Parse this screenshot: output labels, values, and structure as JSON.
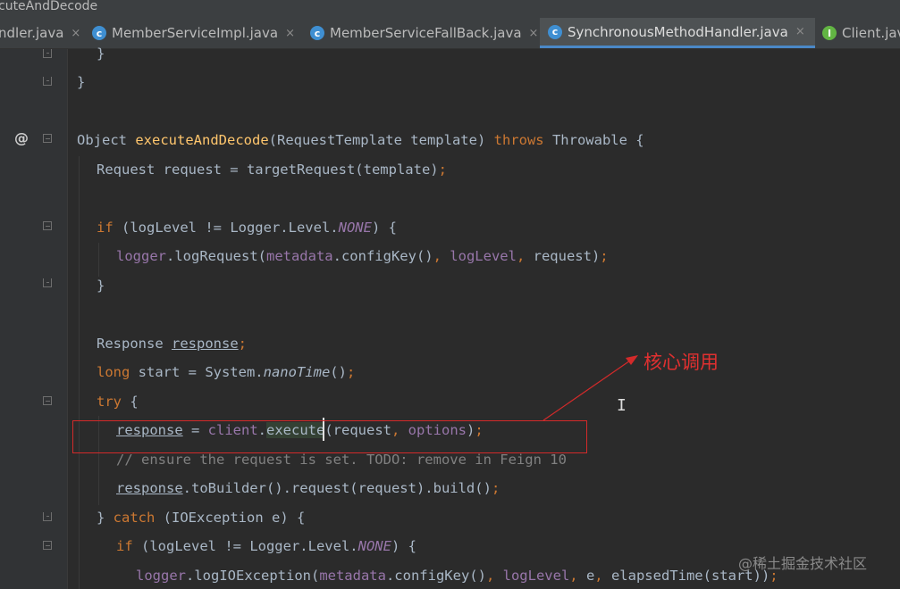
{
  "window": {
    "title": "cuteAndDecode"
  },
  "tabs": [
    {
      "label": "ndler.java",
      "active": false,
      "icon": "none"
    },
    {
      "label": "MemberServiceImpl.java",
      "active": false,
      "icon": "class-icon"
    },
    {
      "label": "MemberServiceFallBack.java",
      "active": false,
      "icon": "class-icon"
    },
    {
      "label": "SynchronousMethodHandler.java",
      "active": true,
      "icon": "class-icon"
    },
    {
      "label": "Client.jav",
      "active": false,
      "icon": "interface-icon"
    }
  ],
  "tab_close": "×",
  "gutter": {
    "override_marker": "@"
  },
  "code": {
    "l1": "}",
    "l2": "}",
    "l3_type": "Object",
    "l3_name": "executeAndDecode",
    "l3_params": "(RequestTemplate template)",
    "l3_throws": "throws",
    "l3_rest": " Throwable {",
    "l4_a": "Request request = targetRequest(template)",
    "l4_semi": ";",
    "l5_if": "if",
    "l5_a": " (logLevel != Logger.Level.",
    "l5_none": "NONE",
    "l5_b": ") {",
    "l6_logger": "logger",
    "l6_a": ".logRequest(",
    "l6_meta": "metadata",
    "l6_b": ".configKey()",
    "l6_c1": ", ",
    "l6_ll": "logLevel",
    "l6_c2": ", ",
    "l6_d": "request)",
    "l6_semi": ";",
    "l7": "}",
    "l8_type": "Response ",
    "l8_var": "response",
    "l8_semi": ";",
    "l9_long": "long",
    "l9_a": " start = System.",
    "l9_nano": "nanoTime",
    "l9_b": "()",
    "l9_semi": ";",
    "l10_try": "try",
    "l10_b": " {",
    "l11_var": "response",
    "l11_a": " = ",
    "l11_client": "client",
    "l11_b": ".",
    "l11_exec": "execute",
    "l11_c": "(request",
    "l11_comma": ", ",
    "l11_opt": "options",
    "l11_d": ")",
    "l11_semi": ";",
    "l12": "// ensure the request is set. TODO: remove in Feign 10",
    "l13_var": "response",
    "l13_a": ".toBuilder().request(request).build()",
    "l13_semi": ";",
    "l14_a": "} ",
    "l14_catch": "catch",
    "l14_b": " (IOException e) {",
    "l15_if": "if",
    "l15_a": " (logLevel != Logger.Level.",
    "l15_none": "NONE",
    "l15_b": ") {",
    "l16_logger": "logger",
    "l16_a": ".logIOException(",
    "l16_meta": "metadata",
    "l16_b": ".configKey()",
    "l16_c1": ", ",
    "l16_ll": "logLevel",
    "l16_c2": ", ",
    "l16_d": "e",
    "l16_c3": ", ",
    "l16_e": "elapsedTime(start))",
    "l16_semi": ";"
  },
  "annotation": {
    "text": "核心调用",
    "color": "#e03030"
  },
  "watermark": "@稀土掘金技术社区",
  "colors": {
    "background": "#2b2b2b",
    "keyword": "#cc7832",
    "method": "#ffc66d",
    "field": "#9876aa",
    "comment": "#808080",
    "text": "#a9b7c6",
    "highlight_box": "#d32a2a"
  }
}
